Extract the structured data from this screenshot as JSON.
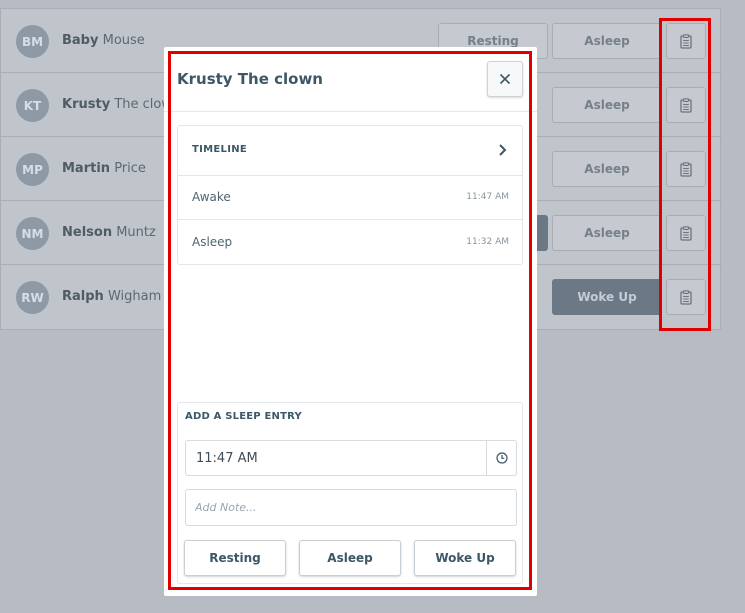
{
  "people": [
    {
      "initials": "BM",
      "first": "Baby",
      "last": "Mouse",
      "buttons": [
        "Resting",
        "Asleep"
      ]
    },
    {
      "initials": "KT",
      "first": "Krusty",
      "last": "The clown",
      "buttons": [
        "",
        "Asleep"
      ]
    },
    {
      "initials": "MP",
      "first": "Martin",
      "last": "Price",
      "buttons": [
        "",
        "Asleep"
      ]
    },
    {
      "initials": "NM",
      "first": "Nelson",
      "last": "Muntz",
      "buttons": [
        "",
        "Asleep"
      ]
    },
    {
      "initials": "RW",
      "first": "Ralph",
      "last": "Wigham",
      "buttons": [
        "",
        "Woke Up"
      ]
    }
  ],
  "modal": {
    "title": "Krusty The clown",
    "timeline": {
      "header": "TIMELINE",
      "entries": [
        {
          "state": "Awake",
          "time": "11:47 AM"
        },
        {
          "state": "Asleep",
          "time": "11:32 AM"
        }
      ]
    },
    "entry_form": {
      "label": "ADD A SLEEP ENTRY",
      "time_value": "11:47 AM",
      "note_placeholder": "Add Note...",
      "buttons": [
        "Resting",
        "Asleep",
        "Woke Up"
      ]
    }
  },
  "colors": {
    "accent": "#3c5867",
    "highlight": "#e00000",
    "dark_button": "#6b7885"
  },
  "icons": {
    "clipboard": "clipboard-icon",
    "close": "close-icon",
    "chevron": "chevron-right-icon",
    "clock": "clock-icon"
  }
}
